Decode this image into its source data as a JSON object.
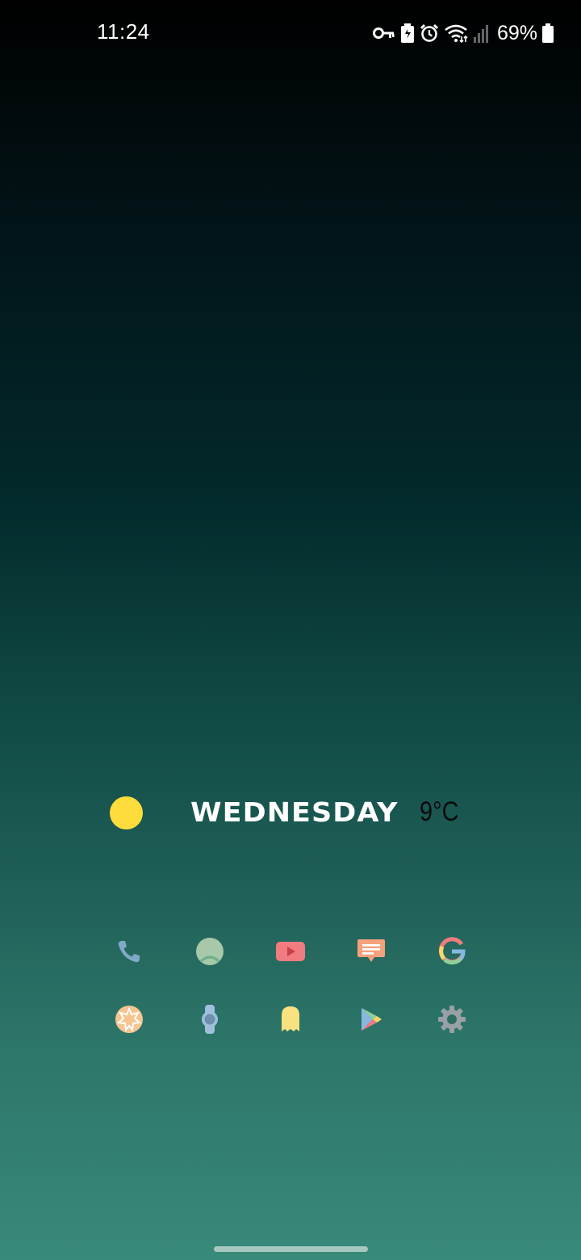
{
  "status_bar": {
    "time": "11:24",
    "battery_percent": "69%",
    "icons": [
      "vpn-key-icon",
      "battery-saver-icon",
      "alarm-icon",
      "wifi-icon",
      "signal-icon",
      "battery-icon"
    ]
  },
  "widget": {
    "weather_icon": "sun-icon",
    "day": "WEDNESDAY",
    "temperature": "9°C",
    "colors": {
      "sun": "#fddc3b",
      "day_text": "#ffffff",
      "temp_text": "#0b0b0b"
    }
  },
  "apps": [
    {
      "icon": "phone-icon",
      "color": "#7fa9c6"
    },
    {
      "icon": "contacts-icon",
      "color": "#a7c9a9"
    },
    {
      "icon": "youtube-icon",
      "color": "#f07c80"
    },
    {
      "icon": "messages-icon",
      "color": "#f5a27c"
    },
    {
      "icon": "google-icon",
      "color": "#e4e4e4"
    },
    {
      "icon": "badge-icon",
      "color": "#f7c48f"
    },
    {
      "icon": "watch-icon",
      "color": "#9ec0dc"
    },
    {
      "icon": "ghost-icon",
      "color": "#f8e17f"
    },
    {
      "icon": "play-store-icon",
      "color": "#88b8e0"
    },
    {
      "icon": "settings-icon",
      "color": "#9aa1a6"
    }
  ]
}
